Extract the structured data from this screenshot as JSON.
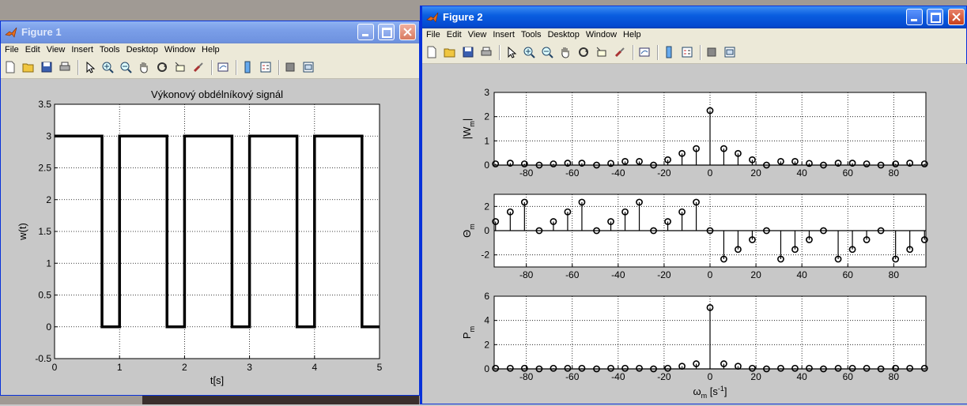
{
  "figure1": {
    "title": "Figure 1",
    "menu": [
      "File",
      "Edit",
      "View",
      "Insert",
      "Tools",
      "Desktop",
      "Window",
      "Help"
    ],
    "chart_data": {
      "type": "line",
      "title": "Výkonový obdélníkový signál",
      "xlabel": "t[s]",
      "ylabel": "w(t)",
      "xlim": [
        0,
        5
      ],
      "ylim": [
        -0.5,
        3.5
      ],
      "xticks": [
        "0",
        "1",
        "2",
        "3",
        "4",
        "5"
      ],
      "yticks": [
        "-0.5",
        "0",
        "0.5",
        "1",
        "1.5",
        "2",
        "2.5",
        "3",
        "3.5"
      ],
      "grid": true,
      "series": [
        {
          "x": [
            0,
            0.73,
            0.73,
            1.0,
            1.0,
            1.73,
            1.73,
            2.0,
            2.0,
            2.73,
            2.73,
            3.0,
            3.0,
            3.73,
            3.73,
            4.0,
            4.0,
            4.73,
            4.73,
            5.0
          ],
          "y": [
            3,
            3,
            0,
            0,
            3,
            3,
            0,
            0,
            3,
            3,
            0,
            0,
            3,
            3,
            0,
            0,
            3,
            3,
            0,
            0
          ]
        }
      ]
    }
  },
  "figure2": {
    "title": "Figure 2",
    "menu": [
      "File",
      "Edit",
      "View",
      "Insert",
      "Tools",
      "Desktop",
      "Window",
      "Help"
    ],
    "chart_data": [
      {
        "type": "scatter",
        "style": "stem",
        "ylabel": "|W",
        "ylabel_sub": "m",
        "ylabel_suffix": "|",
        "xlim": [
          -94,
          94
        ],
        "ylim": [
          0,
          3
        ],
        "xticks": [
          "-80",
          "-60",
          "-40",
          "-20",
          "0",
          "20",
          "40",
          "60",
          "80"
        ],
        "yticks": [
          "0",
          "1",
          "2",
          "3"
        ],
        "grid": true,
        "x": [
          -93.4,
          -87.0,
          -80.8,
          -74.4,
          -68.2,
          -62.0,
          -55.8,
          -49.4,
          -43.2,
          -37.0,
          -30.8,
          -24.6,
          -18.4,
          -12.2,
          -6.0,
          0,
          6.0,
          12.2,
          18.4,
          24.6,
          30.8,
          37.0,
          43.2,
          49.4,
          55.8,
          62.0,
          68.2,
          74.4,
          80.8,
          87.0,
          93.4
        ],
        "y": [
          0.05,
          0.08,
          0.05,
          0.0,
          0.05,
          0.08,
          0.08,
          0.0,
          0.07,
          0.15,
          0.15,
          0.0,
          0.22,
          0.48,
          0.68,
          2.25,
          0.68,
          0.48,
          0.22,
          0.0,
          0.15,
          0.15,
          0.07,
          0.0,
          0.08,
          0.08,
          0.05,
          0.0,
          0.05,
          0.08,
          0.05
        ]
      },
      {
        "type": "scatter",
        "style": "stem",
        "ylabel": "Θ",
        "ylabel_sub": "m",
        "xlim": [
          -94,
          94
        ],
        "ylim": [
          -3,
          3
        ],
        "xticks": [
          "-80",
          "-60",
          "-40",
          "-20",
          "0",
          "20",
          "40",
          "60",
          "80"
        ],
        "yticks": [
          "-2",
          "0",
          "2"
        ],
        "grid": true,
        "x": [
          -93.4,
          -87.0,
          -80.8,
          -74.4,
          -68.2,
          -62.0,
          -55.8,
          -49.4,
          -43.2,
          -37.0,
          -30.8,
          -24.6,
          -18.4,
          -12.2,
          -6.0,
          0,
          6.0,
          12.2,
          18.4,
          24.6,
          30.8,
          37.0,
          43.2,
          49.4,
          55.8,
          62.0,
          68.2,
          74.4,
          80.8,
          87.0,
          93.4
        ],
        "y": [
          0.75,
          1.55,
          2.35,
          0.0,
          0.75,
          1.55,
          2.35,
          0.0,
          0.75,
          1.55,
          2.35,
          0.0,
          0.75,
          1.55,
          2.35,
          0.0,
          -2.35,
          -1.55,
          -0.75,
          0.0,
          -2.35,
          -1.55,
          -0.75,
          0.0,
          -2.35,
          -1.55,
          -0.75,
          0.0,
          -2.35,
          -1.55,
          -0.75
        ]
      },
      {
        "type": "scatter",
        "style": "stem",
        "ylabel": "P",
        "ylabel_sub": "m",
        "xlabel": "ω",
        "xlabel_sub": "m",
        "xlabel_suffix": " [s",
        "xlabel_sup": "-1",
        "xlabel_end": "]",
        "xlim": [
          -94,
          94
        ],
        "ylim": [
          0,
          6
        ],
        "xticks": [
          "-80",
          "-60",
          "-40",
          "-20",
          "0",
          "20",
          "40",
          "60",
          "80"
        ],
        "yticks": [
          "0",
          "2",
          "4",
          "6"
        ],
        "grid": true,
        "x": [
          -93.4,
          -87.0,
          -80.8,
          -74.4,
          -68.2,
          -62.0,
          -55.8,
          -49.4,
          -43.2,
          -37.0,
          -30.8,
          -24.6,
          -18.4,
          -12.2,
          -6.0,
          0,
          6.0,
          12.2,
          18.4,
          24.6,
          30.8,
          37.0,
          43.2,
          49.4,
          55.8,
          62.0,
          68.2,
          74.4,
          80.8,
          87.0,
          93.4
        ],
        "y": [
          0.05,
          0.05,
          0.05,
          0.0,
          0.05,
          0.05,
          0.05,
          0.0,
          0.05,
          0.05,
          0.05,
          0.0,
          0.05,
          0.22,
          0.42,
          5.06,
          0.42,
          0.22,
          0.05,
          0.0,
          0.05,
          0.05,
          0.05,
          0.0,
          0.05,
          0.05,
          0.05,
          0.0,
          0.05,
          0.05,
          0.05
        ]
      }
    ]
  },
  "colors": {
    "plot_bg": "#ffffff",
    "figure_bg": "#c8c8c8",
    "title_active": "#0a5ee0",
    "title_inactive": "#7a9ee8"
  },
  "toolbar_icons": [
    "new-file-icon",
    "open-icon",
    "save-icon",
    "print-icon",
    "pointer-icon",
    "zoom-in-icon",
    "zoom-out-icon",
    "pan-hand-icon",
    "rotate-3d-icon",
    "data-cursor-icon",
    "brush-icon",
    "link-plot-icon",
    "colorbar-icon",
    "legend-icon",
    "hide-plot-tools-icon",
    "show-plot-tools-icon"
  ]
}
